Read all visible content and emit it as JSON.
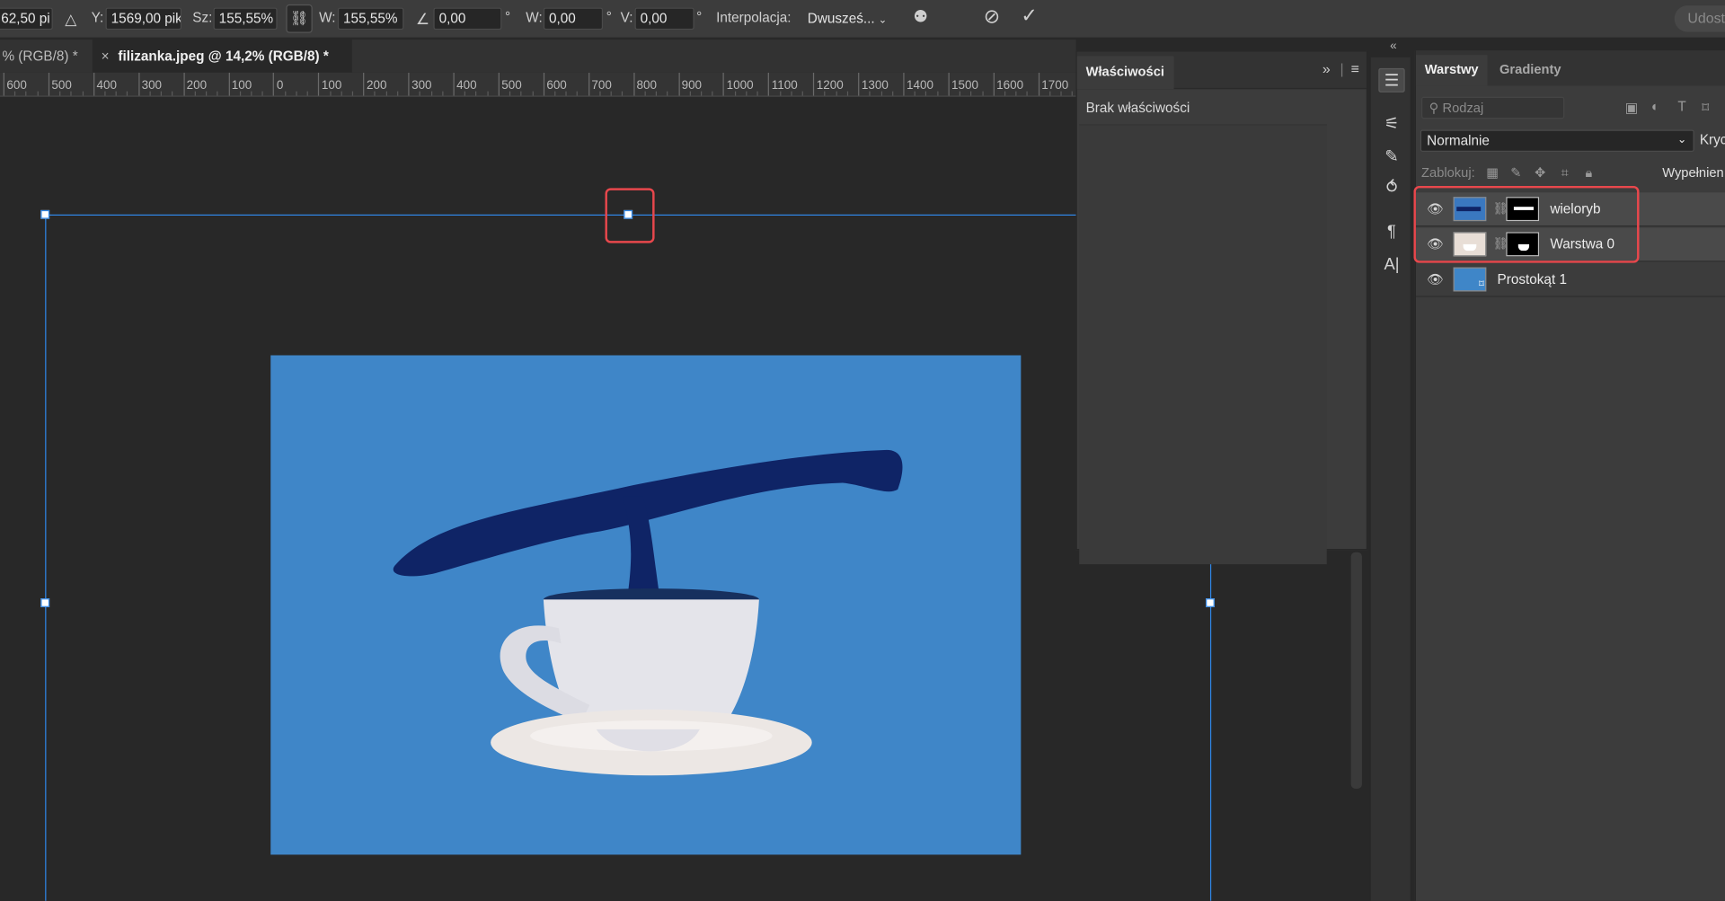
{
  "options_bar": {
    "x_value": "62,50 pi",
    "y_label": "Y:",
    "y_value": "1569,00 pik",
    "sz_label": "Sz:",
    "sz_value": "155,55%",
    "w_label": "W:",
    "w_value": "155,55%",
    "angle_value": "0,00",
    "degree": "°",
    "skew_w_label": "W:",
    "skew_w_value": "0,00",
    "skew_v_label": "V:",
    "skew_v_value": "0,00",
    "interp_label": "Interpolacja:",
    "interp_value": "Dwusześ...",
    "share_label": "Udost"
  },
  "tabs": [
    {
      "label": "% (RGB/8) *"
    },
    {
      "label": "filizanka.jpeg @ 14,2% (RGB/8) *",
      "close": "×"
    }
  ],
  "ruler": {
    "labels": [
      "600",
      "500",
      "400",
      "300",
      "200",
      "100",
      "0",
      "100",
      "200",
      "300",
      "400",
      "500",
      "600",
      "700",
      "800",
      "900",
      "1000",
      "1100",
      "1200",
      "1300",
      "1400",
      "1500",
      "1600",
      "1700"
    ]
  },
  "properties": {
    "tab_label": "Właściwości",
    "empty_text": "Brak właściwości"
  },
  "toolstrip": {
    "icons": [
      "adjustments-icon",
      "brush-settings-icon",
      "brush-icon",
      "history-icon",
      "paragraph-icon",
      "character-icon"
    ]
  },
  "layers_panel": {
    "tabs": [
      "Warstwy",
      "Gradienty"
    ],
    "filter_placeholder": "Rodzaj",
    "blend_mode": "Normalnie",
    "opacity_label": "Kryc",
    "lock_label": "Zablokuj:",
    "fill_label": "Wypełnien",
    "layers": [
      {
        "name": "wieloryb",
        "visible": true,
        "selected": true
      },
      {
        "name": "Warstwa 0",
        "visible": true,
        "selected": true
      },
      {
        "name": "Prostokąt 1",
        "visible": true,
        "selected": false
      }
    ]
  },
  "colors": {
    "guide": "#2f86e6",
    "highlight": "#e8474c",
    "canvas_bg": "#3f86c8"
  }
}
